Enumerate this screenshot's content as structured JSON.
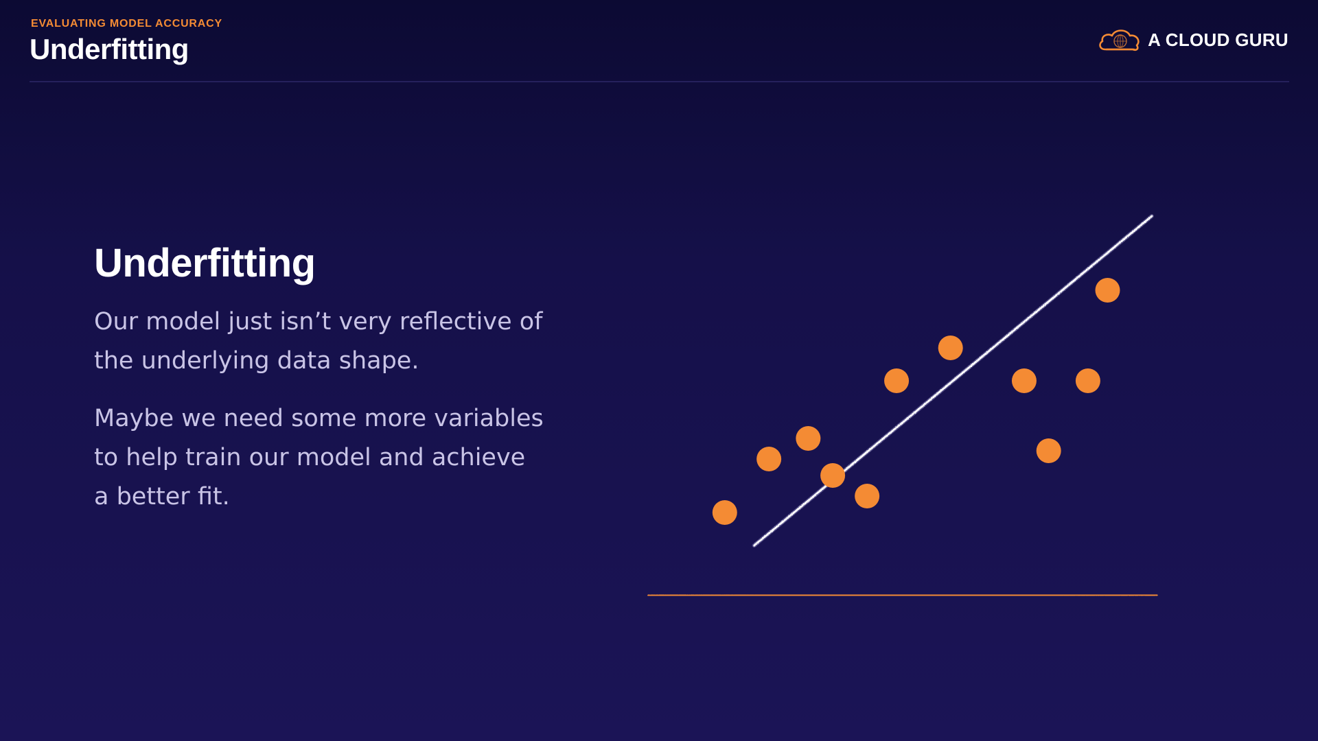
{
  "header": {
    "eyebrow": "EVALUATING MODEL ACCURACY",
    "title": "Underfitting"
  },
  "brand": {
    "name": "A CLOUD GURU",
    "icon": "cloud-logo-icon",
    "color": "#f48b34"
  },
  "content": {
    "heading": "Underfitting",
    "paragraph1": "Our model just isn’t very reflective of the underlying data shape.",
    "paragraph2": "Maybe we need some more variables to help train our model and achieve a better fit."
  },
  "colors": {
    "background": "#151049",
    "accent": "#f48b34",
    "fit_line": "#ffffff"
  },
  "chart_data": {
    "type": "scatter",
    "title": "",
    "xlabel": "",
    "ylabel": "",
    "xlim": [
      0,
      100
    ],
    "ylim": [
      0,
      100
    ],
    "grid": false,
    "points": [
      {
        "x": 12,
        "y": 18
      },
      {
        "x": 21,
        "y": 31
      },
      {
        "x": 29,
        "y": 36
      },
      {
        "x": 34,
        "y": 27
      },
      {
        "x": 41,
        "y": 22
      },
      {
        "x": 47,
        "y": 50
      },
      {
        "x": 58,
        "y": 58
      },
      {
        "x": 73,
        "y": 50
      },
      {
        "x": 78,
        "y": 33
      },
      {
        "x": 86,
        "y": 50
      },
      {
        "x": 90,
        "y": 72
      }
    ],
    "fit_line": {
      "x1": 18,
      "y1": 10,
      "x2": 99,
      "y2": 90
    }
  }
}
